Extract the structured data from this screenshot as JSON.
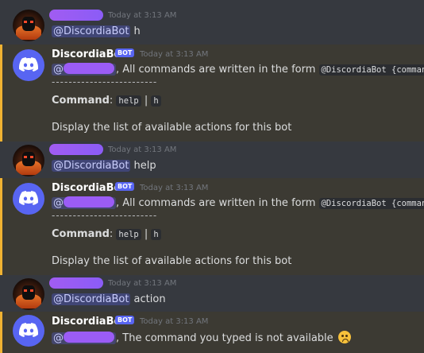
{
  "messages": [
    {
      "kind": "user",
      "time": "Today at 3:13 AM",
      "mention": "@DiscordiaBot",
      "text": " h"
    },
    {
      "kind": "bot",
      "author": "DiscordiaBot",
      "badge": "BOT",
      "time": "Today at 3:13 AM",
      "mention_prefix": "@",
      "intro": ", All commands are written in the form ",
      "form_code": "@DiscordiaBot {command}",
      "intro_end": ":",
      "dashes": "-------------------------",
      "command_label": "Command",
      "command_colon": ": ",
      "command_code_1": "help",
      "command_sep": " | ",
      "command_code_2": "h",
      "description": "Display the list of available actions for this bot"
    },
    {
      "kind": "user",
      "time": "Today at 3:13 AM",
      "mention": "@DiscordiaBot",
      "text": " help"
    },
    {
      "kind": "bot",
      "author": "DiscordiaBot",
      "badge": "BOT",
      "time": "Today at 3:13 AM",
      "mention_prefix": "@",
      "intro": ", All commands are written in the form ",
      "form_code": "@DiscordiaBot {command}",
      "intro_end": ":",
      "dashes": "-------------------------",
      "command_label": "Command",
      "command_colon": ": ",
      "command_code_1": "help",
      "command_sep": " | ",
      "command_code_2": "h",
      "description": "Display the list of available actions for this bot"
    },
    {
      "kind": "user",
      "time": "Today at 3:13 AM",
      "mention": "@DiscordiaBot",
      "text": " action"
    },
    {
      "kind": "bot",
      "author": "DiscordiaBot",
      "badge": "BOT",
      "time": "Today at 3:13 AM",
      "mention_prefix": "@",
      "intro": ", The command you typed is not available",
      "emoji": "slightly-frowning-face-icon"
    }
  ],
  "colors": {
    "background": "#36393f",
    "highlight_bg": "#3c3a33",
    "highlight_bar": "#f0b232",
    "mention": "#c9cdfb",
    "badge": "#5865f2",
    "redaction": "#9b5cf5"
  }
}
